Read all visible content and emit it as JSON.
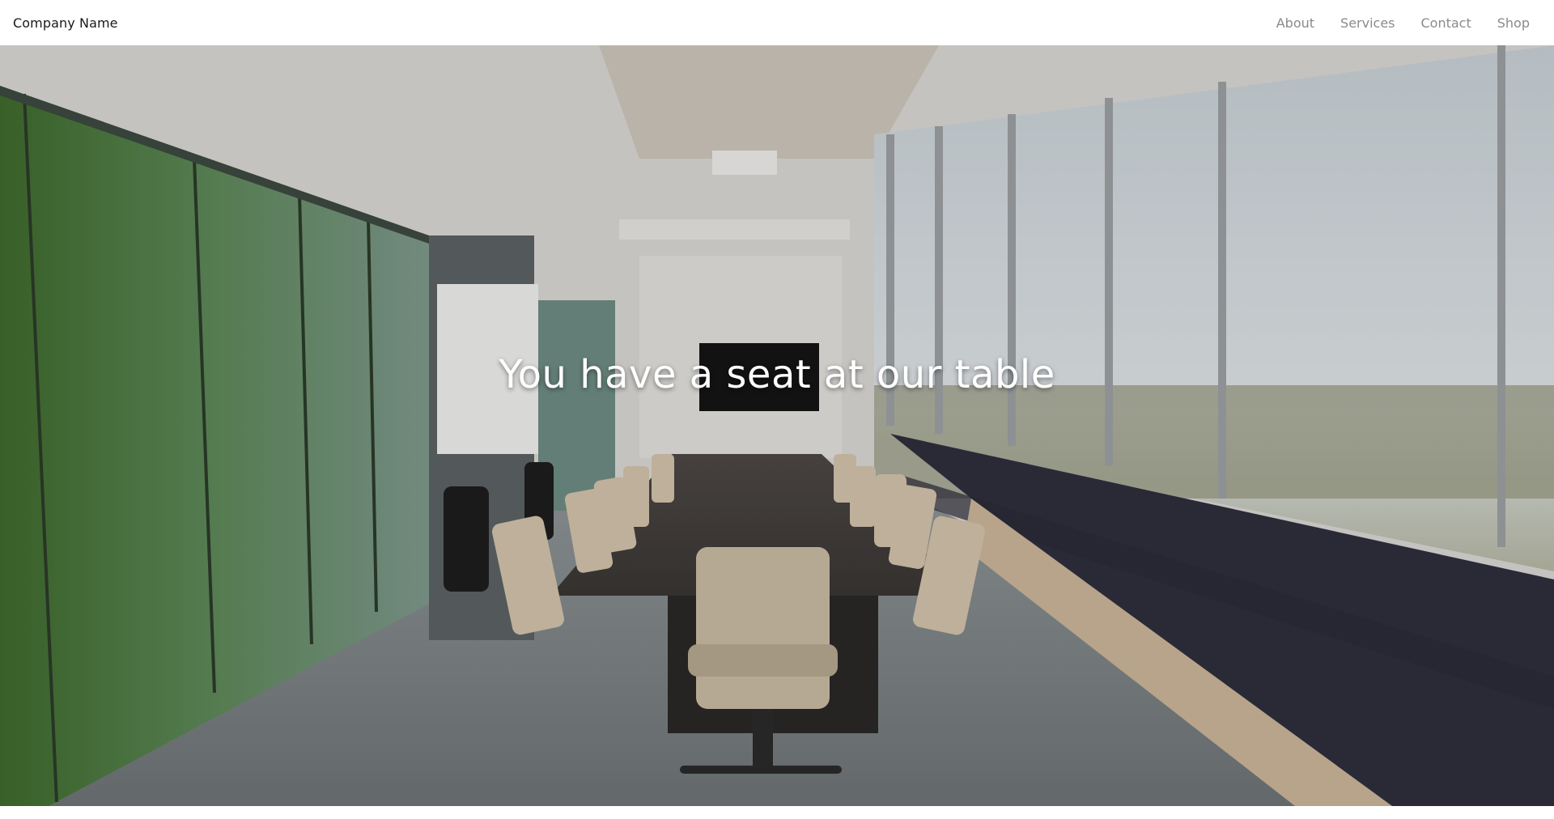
{
  "navbar": {
    "brand": "Company Name",
    "links": [
      {
        "label": "About"
      },
      {
        "label": "Services"
      },
      {
        "label": "Contact"
      },
      {
        "label": "Shop"
      }
    ]
  },
  "hero": {
    "title": "You have a seat at our table",
    "image": "conference-room-photo"
  },
  "colors": {
    "nav_link": "#8a8a8a",
    "brand_text": "#1a1a1a",
    "hero_title": "#ffffff"
  }
}
